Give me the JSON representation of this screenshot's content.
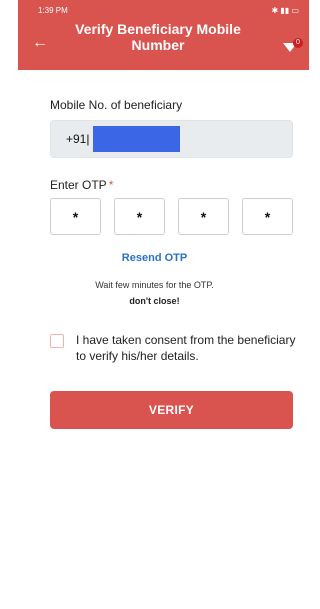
{
  "statusbar": {
    "time": "1:39 PM",
    "icons_right": "bluetooth signal battery"
  },
  "header": {
    "title": "Verify Beneficiary Mobile Number",
    "back_icon": "arrow-left-icon",
    "notification_count": "0"
  },
  "mobile": {
    "label": "Mobile No. of beneficiary",
    "prefix": "+91|"
  },
  "otp": {
    "label": "Enter OTP",
    "required_mark": "*",
    "digits": [
      "*",
      "*",
      "*",
      "*"
    ]
  },
  "resend": {
    "label": "Resend OTP"
  },
  "message": {
    "wait": "Wait few minutes for the OTP.",
    "dont_close": "don't close!"
  },
  "consent": {
    "text": "I have taken consent from the beneficiary to verify his/her details."
  },
  "actions": {
    "verify_label": "VERIFY"
  },
  "colors": {
    "accent": "#d9534f",
    "link": "#2a72c7",
    "redaction": "#3b66e6"
  }
}
